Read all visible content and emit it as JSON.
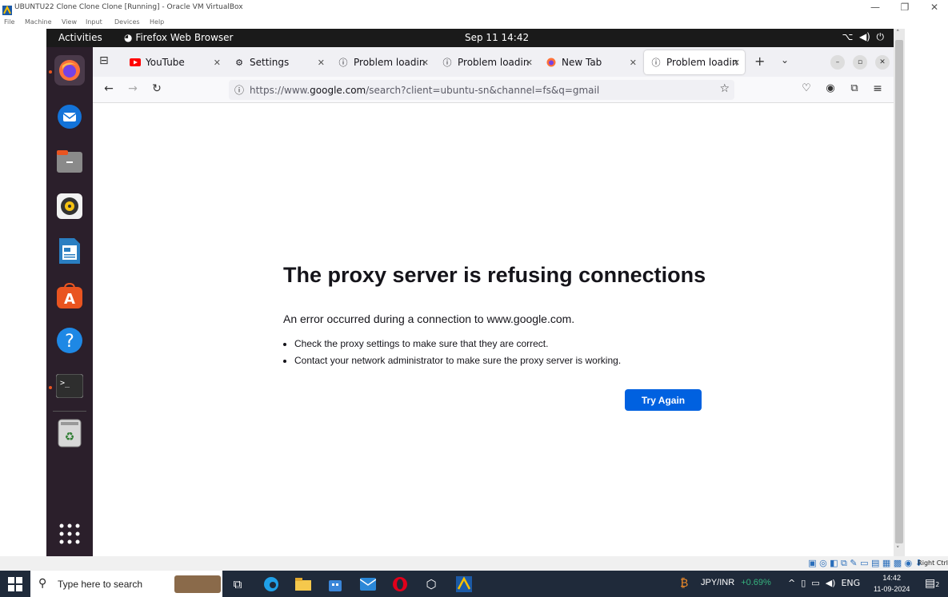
{
  "vbox": {
    "title": "UBUNTU22 Clone Clone Clone [Running] - Oracle VM VirtualBox",
    "menu": [
      "File",
      "Machine",
      "View",
      "Input",
      "Devices",
      "Help"
    ],
    "status_right": "Right Ctrl"
  },
  "gnome": {
    "activities": "Activities",
    "app_name": "Firefox Web Browser",
    "clock": "Sep 11  14:42"
  },
  "dock": {
    "items": [
      "firefox-icon",
      "thunderbird-icon",
      "files-icon",
      "rhythmbox-icon",
      "libreoffice-writer-icon",
      "app-center-icon",
      "help-icon",
      "terminal-icon",
      "trash-icon",
      "show-apps-icon"
    ]
  },
  "firefox": {
    "tabs": [
      {
        "label": "YouTube",
        "icon": "youtube-icon"
      },
      {
        "label": "Settings",
        "icon": "gear-icon"
      },
      {
        "label": "Problem loadin",
        "icon": "info-icon"
      },
      {
        "label": "Problem loadin",
        "icon": "info-icon"
      },
      {
        "label": "New Tab",
        "icon": "firefox-icon"
      },
      {
        "label": "Problem loadin",
        "icon": "info-icon"
      }
    ],
    "url_prefix": "https://www.",
    "url_host": "google.com",
    "url_path": "/search?client=ubuntu-sn&channel=fs&q=gmail",
    "error": {
      "title": "The proxy server is refusing connections",
      "description": "An error occurred during a connection to www.google.com.",
      "bullets": [
        "Check the proxy settings to make sure that they are correct.",
        "Contact your network administrator to make sure the proxy server is working."
      ],
      "button": "Try Again"
    }
  },
  "taskbar": {
    "search_placeholder": "Type here to search",
    "ticker_symbol": "JPY/INR",
    "ticker_change": "+0.69%",
    "lang": "ENG",
    "time": "14:42",
    "date": "11-09-2024",
    "notif_count": "2"
  },
  "colors": {
    "accent": "#0061e0",
    "ubuntu_orange": "#e95420",
    "dock_bg": "#2b1f2b",
    "taskbar_bg": "#1f2a3a"
  }
}
